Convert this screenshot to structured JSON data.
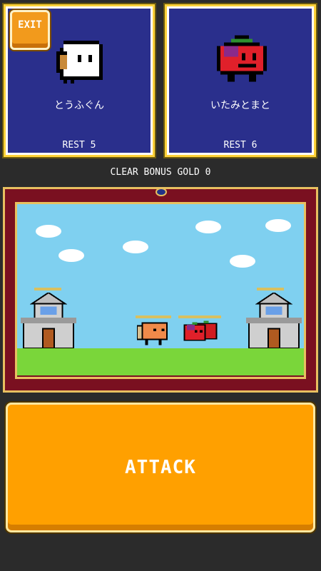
{
  "exit_label": "EXIT",
  "player_unit": {
    "name": "とうふぐん",
    "rest": "REST 5"
  },
  "enemy_unit": {
    "name": "いたみとまと",
    "rest": "REST 6"
  },
  "clear_bonus": "CLEAR BONUS GOLD 0",
  "attack_label": "ATTACK",
  "colors": {
    "panel_bg": "#2a2f8c",
    "panel_border": "#ffd23a",
    "sky": "#7fd0f0",
    "grass": "#7ad63a",
    "attack": "#ffa000",
    "frame": "#7a1020"
  }
}
